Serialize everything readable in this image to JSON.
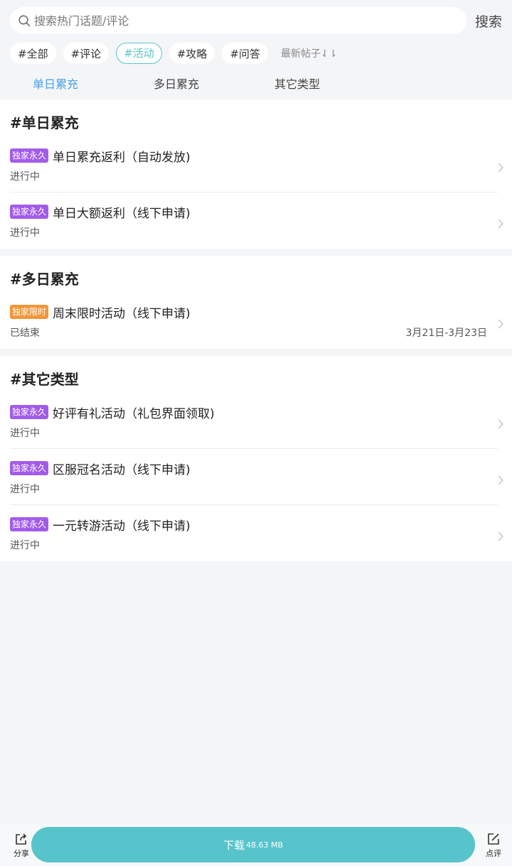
{
  "search": {
    "placeholder": "搜索热门话题/评论",
    "button": "搜索"
  },
  "tags": [
    "#全部",
    "#评论",
    "#活动",
    "#攻略",
    "#问答"
  ],
  "active_tag": "#活动",
  "sort": {
    "label": "最新帖子⇃⇂"
  },
  "tabs": [
    {
      "label": "单日累充",
      "active": true
    },
    {
      "label": "多日累充",
      "active": false
    },
    {
      "label": "其它类型",
      "active": false
    }
  ],
  "sections": [
    {
      "title": "#单日累充",
      "items": [
        {
          "badge": "独家永久",
          "title": "单日累充返利（自动发放)",
          "status": "进行中",
          "date": ""
        },
        {
          "badge": "独家永久",
          "title": "单日大额返利（线下申请)",
          "status": "进行中",
          "date": ""
        }
      ]
    },
    {
      "title": "#多日累充",
      "items": [
        {
          "badge": "独家限时",
          "title": "周末限时活动（线下申请)",
          "status": "已结束",
          "date": "3月21日-3月23日"
        }
      ]
    },
    {
      "title": "#其它类型",
      "items": [
        {
          "badge": "独家永久",
          "title": "好评有礼活动（礼包界面领取)",
          "status": "进行中",
          "date": ""
        },
        {
          "badge": "独家永久",
          "title": "区服冠名活动（线下申请)",
          "status": "进行中",
          "date": ""
        },
        {
          "badge": "独家永久",
          "title": "一元转游活动（线下申请)",
          "status": "进行中",
          "date": ""
        }
      ]
    }
  ],
  "bottom": {
    "share": "分享",
    "download": "下载",
    "size": "48.63 MB",
    "review": "点评"
  },
  "colors": {
    "accent": "#57c4cb",
    "tab_active": "#4a9fe8",
    "badge_purple": "#a25be9",
    "badge_orange": "#f1973a"
  }
}
